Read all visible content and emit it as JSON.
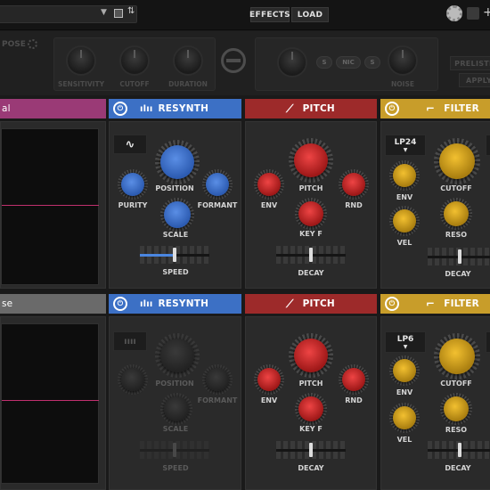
{
  "colors": {
    "resynth": "#3c70c5",
    "pitch": "#9d2a2a",
    "filter": "#c89d2a",
    "layer1": "#9a3a76",
    "layer2": "#6a6a6a"
  },
  "topbar": {
    "effects_label": "EFFECTS",
    "load_label": "LOAD",
    "icons": [
      "save-icon",
      "sort-icon",
      "gear-icon",
      "next-icon",
      "add-icon"
    ]
  },
  "controls": {
    "transpose_label": "POSE",
    "sensitivity_label": "SENSITIVITY",
    "cutoff_label": "CUTOFF",
    "duration_label": "DURATION",
    "pills": [
      "S",
      "NIC",
      "S"
    ],
    "noise_label": "NOISE",
    "prelisten_label": "PRELISTE",
    "apply_label": "APPLY"
  },
  "layers": [
    {
      "name": "al",
      "resynth": {
        "title": "RESYNTH",
        "knobs": {
          "position": "POSITION",
          "purity": "PURITY",
          "formant": "FORMANT",
          "scale": "SCALE"
        },
        "speed_label": "SPEED",
        "speed": 0.5
      },
      "pitch": {
        "title": "PITCH",
        "knobs": {
          "pitch": "PITCH",
          "env": "ENV",
          "rnd": "RND",
          "keyf": "KEY F"
        },
        "decay_label": "DECAY",
        "decay": 0.5
      },
      "filter": {
        "title": "FILTER",
        "type": "LP24",
        "knobs": {
          "env": "ENV",
          "cutoff": "CUTOFF",
          "vel": "VEL",
          "reso": "RESO"
        },
        "decay_label": "DECAY",
        "decay": 0.5
      }
    },
    {
      "name": "se",
      "resynth": {
        "title": "RESYNTH",
        "knobs": {
          "position": "POSITION",
          "purity": "",
          "formant": "FORMANT",
          "scale": "SCALE"
        },
        "speed_label": "SPEED",
        "speed": 0.5
      },
      "pitch": {
        "title": "PITCH",
        "knobs": {
          "pitch": "PITCH",
          "env": "ENV",
          "rnd": "RND",
          "keyf": "KEY F"
        },
        "decay_label": "DECAY",
        "decay": 0.5
      },
      "filter": {
        "title": "FILTER",
        "type": "LP6",
        "knobs": {
          "env": "ENV",
          "cutoff": "CUTOFF",
          "vel": "VEL",
          "reso": "RESO"
        },
        "decay_label": "DECAY",
        "decay": 0.5
      }
    }
  ]
}
